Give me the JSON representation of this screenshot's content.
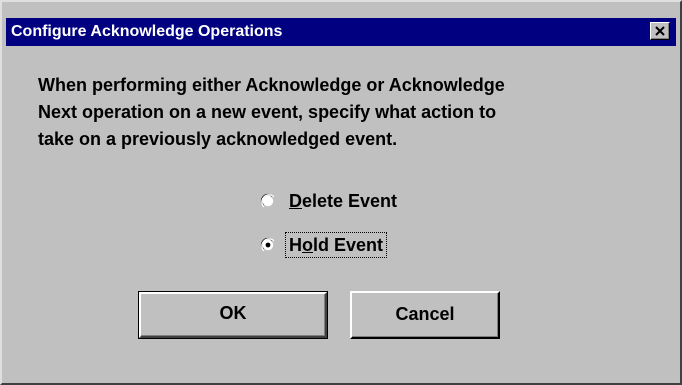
{
  "window": {
    "title": "Configure Acknowledge Operations",
    "close_icon": "close-x-icon"
  },
  "message": {
    "line1": "When performing either Acknowledge or Acknowledge",
    "line2": "Next operation on a new event, specify what action to",
    "line3": "take on a previously acknowledged event."
  },
  "options": [
    {
      "mnemonic": "D",
      "rest": "elete Event",
      "selected": false
    },
    {
      "pre": "H",
      "mnemonic": "o",
      "rest": "ld Event",
      "selected": true
    }
  ],
  "buttons": {
    "ok_label": "OK",
    "cancel_label": "Cancel"
  },
  "colors": {
    "titlebar": "#000080",
    "face": "#c0c0c0"
  }
}
